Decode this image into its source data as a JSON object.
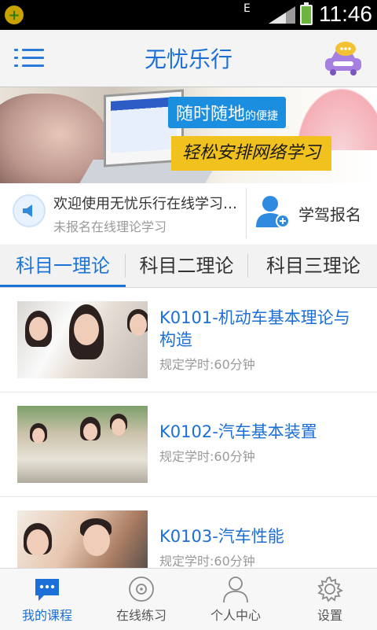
{
  "status_bar": {
    "time": "11:46",
    "network_type": "E"
  },
  "header": {
    "title": "无忧乐行"
  },
  "banner": {
    "slogan_main": "随时随地",
    "slogan_particle": "的便捷",
    "slogan_sub": "轻松安排网络学习"
  },
  "notice": {
    "welcome": "欢迎使用无忧乐行在线学习平台",
    "status": "未报名在线理论学习",
    "register_label": "学驾报名"
  },
  "tabs": [
    {
      "label": "科目一理论",
      "active": true
    },
    {
      "label": "科目二理论",
      "active": false
    },
    {
      "label": "科目三理论",
      "active": false
    }
  ],
  "courses": [
    {
      "title": "K0101-机动车基本理论与构造",
      "meta": "规定学时:60分钟"
    },
    {
      "title": "K0102-汽车基本装置",
      "meta": "规定学时:60分钟"
    },
    {
      "title": "K0103-汽车性能",
      "meta": "规定学时:60分钟"
    }
  ],
  "bottom_nav": [
    {
      "label": "我的课程",
      "icon": "chat-bubble-icon",
      "active": true
    },
    {
      "label": "在线练习",
      "icon": "disc-icon",
      "active": false
    },
    {
      "label": "个人中心",
      "icon": "person-icon",
      "active": false
    },
    {
      "label": "设置",
      "icon": "gear-icon",
      "active": false
    }
  ],
  "colors": {
    "accent": "#1b6fd6",
    "header_bg": "#f4f4f4",
    "banner_yellow": "#f1c21d"
  }
}
